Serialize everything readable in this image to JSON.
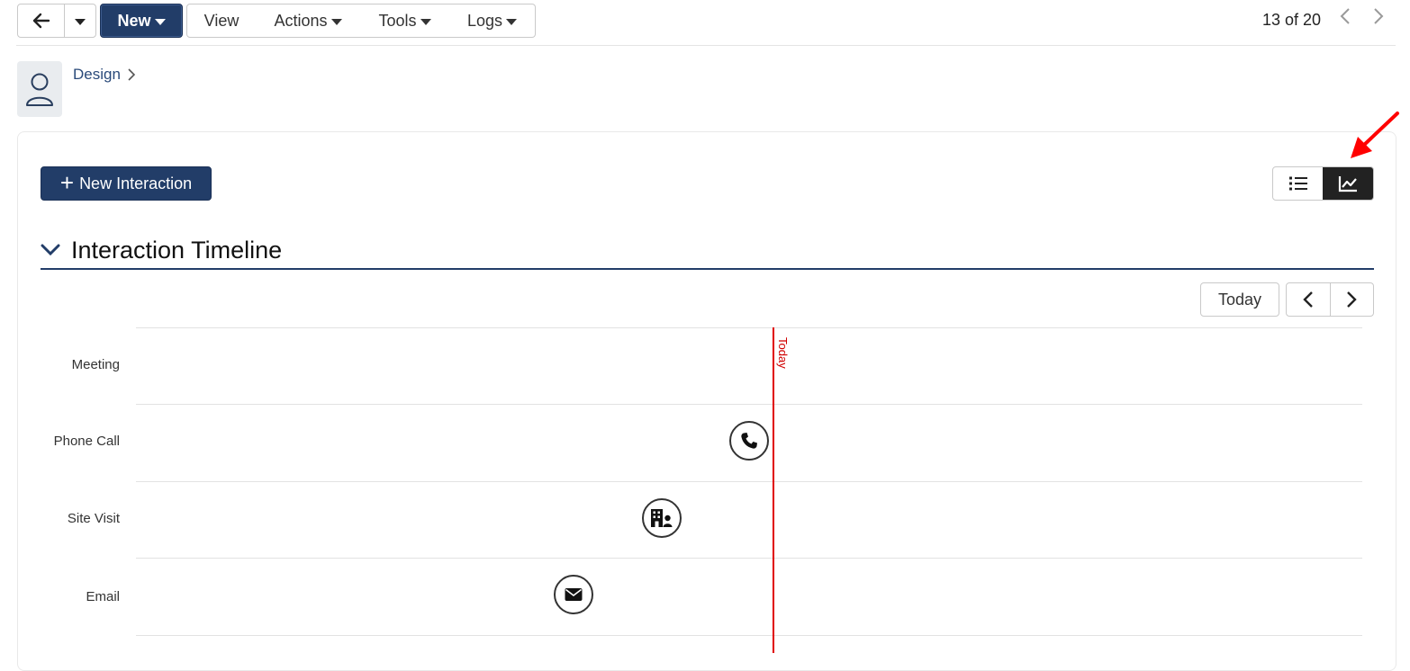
{
  "toolbar": {
    "new_label": "New",
    "view_label": "View",
    "actions_label": "Actions",
    "tools_label": "Tools",
    "logs_label": "Logs",
    "pager_text": "13 of 20"
  },
  "record": {
    "breadcrumb": "Design"
  },
  "card": {
    "new_interaction_label": "New Interaction",
    "section_title": "Interaction Timeline",
    "today_button": "Today",
    "view_toggle": {
      "list_icon": "list-icon",
      "chart_icon": "chart-line-icon",
      "active": "chart"
    }
  },
  "timeline": {
    "today_marker": "Today",
    "rows": [
      {
        "label": "Meeting"
      },
      {
        "label": "Phone Call",
        "icon": "phone-icon"
      },
      {
        "label": "Site Visit",
        "icon": "building-person-icon"
      },
      {
        "label": "Email",
        "icon": "envelope-icon"
      }
    ]
  },
  "colors": {
    "primary": "#223d68",
    "today_line": "#e00000",
    "annotation_arrow": "#ff0000"
  }
}
